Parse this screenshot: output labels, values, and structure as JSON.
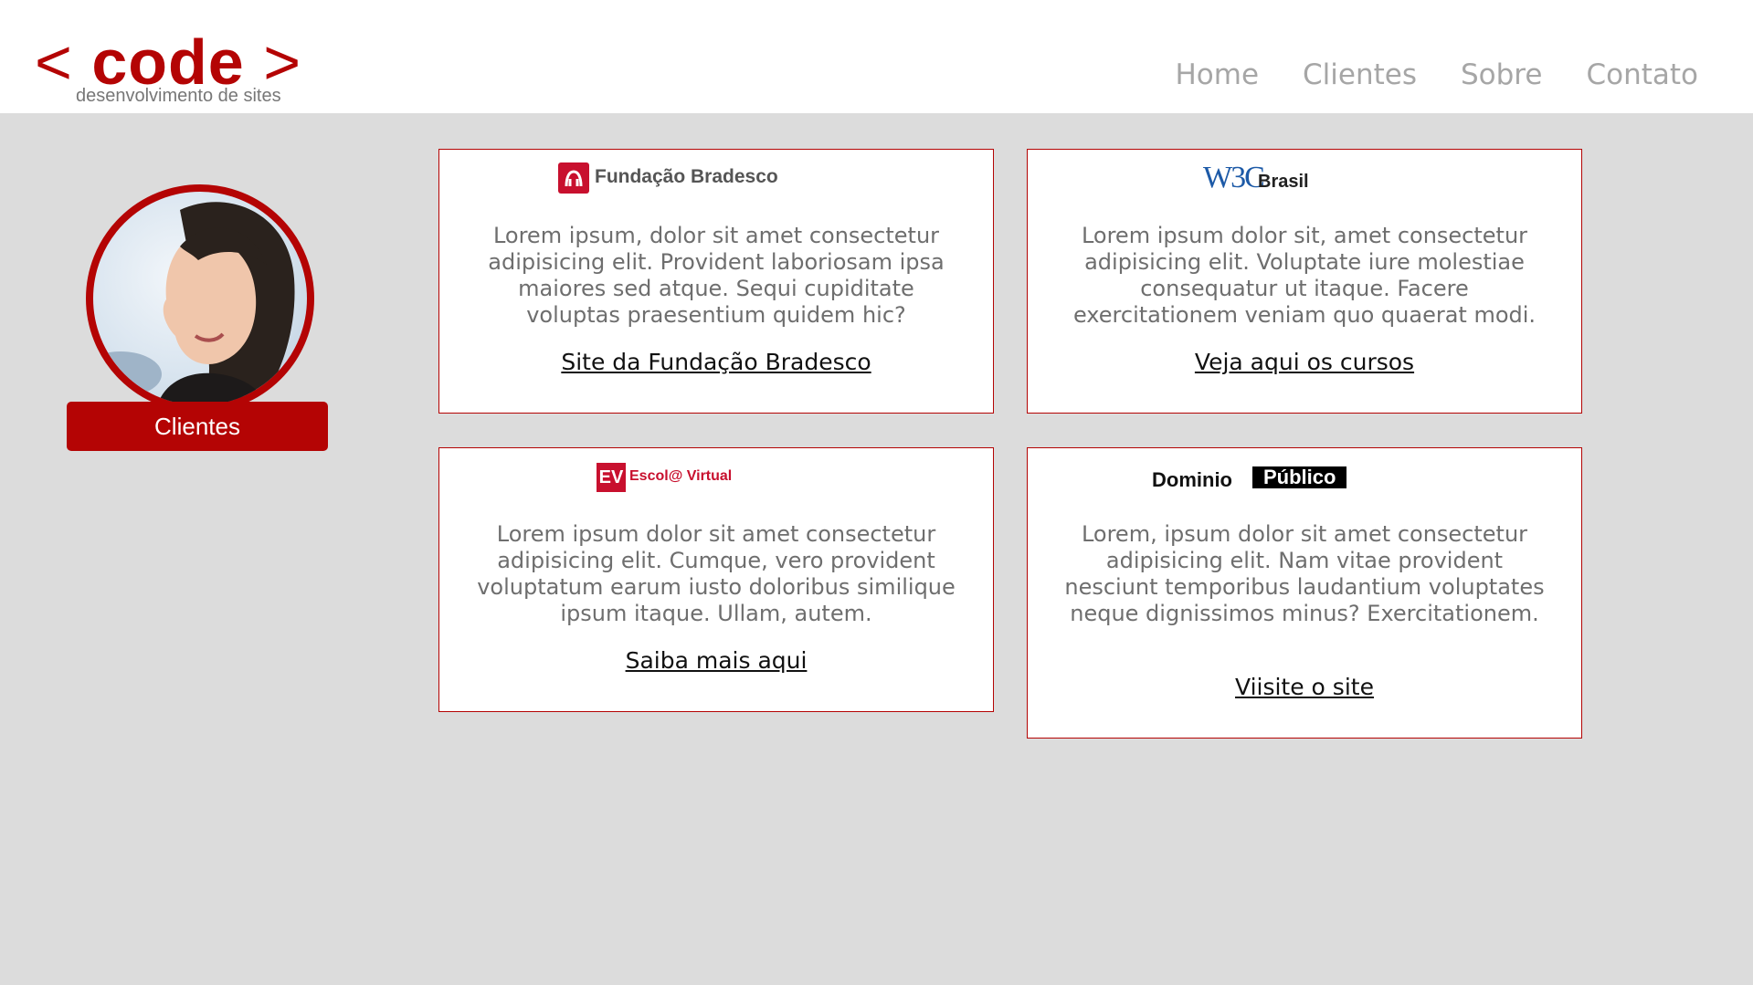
{
  "header": {
    "logo": {
      "main_open": "<",
      "main_word": "code",
      "main_close": ">",
      "tagline": "desenvolvimento de sites"
    },
    "nav": [
      "Home",
      "Clientes",
      "Sobre",
      "Contato"
    ]
  },
  "sidebar": {
    "badge_label": "Clientes"
  },
  "colors": {
    "accent": "#b40404",
    "page_bg": "#dcdcdc",
    "nav_text": "#a6a6a6",
    "body_text": "#6e6e6e"
  },
  "cards": [
    {
      "logo_text": "Fundação Bradesco",
      "text": "Lorem ipsum, dolor sit amet consectetur adipisicing elit. Provident laboriosam ipsa maiores sed atque. Sequi cupiditate voluptas praesentium quidem hic?",
      "link": "Site da Fundação Bradesco"
    },
    {
      "logo_text": "W3C",
      "logo_sub": "Brasil",
      "text": "Lorem ipsum dolor sit, amet consectetur adipisicing elit. Voluptate iure molestiae consequatur ut itaque. Facere exercitationem veniam quo quaerat modi.",
      "link": "Veja aqui os cursos"
    },
    {
      "logo_icon": "EV",
      "logo_text": "Escol@ Virtual",
      "text": "Lorem ipsum dolor sit amet consectetur adipisicing elit. Cumque, vero provident voluptatum earum iusto doloribus similique ipsum itaque. Ullam, autem.",
      "link": "Saiba mais aqui"
    },
    {
      "logo_text": "Dominio",
      "logo_sub": "Público",
      "text": "Lorem, ipsum dolor sit amet consectetur adipisicing elit. Nam vitae provident nesciunt temporibus laudantium voluptates neque dignissimos minus? Exercitationem.",
      "link": "Viisite o site"
    }
  ]
}
